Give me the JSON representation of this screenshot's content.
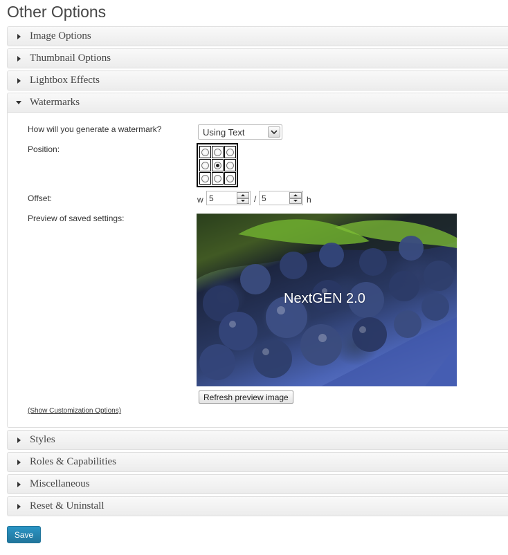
{
  "page": {
    "title": "Other Options"
  },
  "sections_top": [
    {
      "label": "Image Options"
    },
    {
      "label": "Thumbnail Options"
    },
    {
      "label": "Lightbox Effects"
    }
  ],
  "watermarks": {
    "label": "Watermarks",
    "generate_label": "How will you generate a watermark?",
    "generate_value": "Using Text",
    "position_label": "Position:",
    "position_selected": "center",
    "offset_label": "Offset:",
    "offset_w_prefix": "w",
    "offset_w": "5",
    "offset_sep": "/",
    "offset_h": "5",
    "offset_h_suffix": "h",
    "preview_label": "Preview of saved settings:",
    "preview_watermark_text": "NextGEN 2.0",
    "refresh_label": "Refresh preview image",
    "customize_link": "(Show Customization Options)"
  },
  "sections_bottom": [
    {
      "label": "Styles"
    },
    {
      "label": "Roles & Capabilities"
    },
    {
      "label": "Miscellaneous"
    },
    {
      "label": "Reset & Uninstall"
    }
  ],
  "save_label": "Save",
  "colors": {
    "primary_button": "#21759b",
    "header_bg": "#f1f1f1",
    "border": "#dfdfdf"
  }
}
